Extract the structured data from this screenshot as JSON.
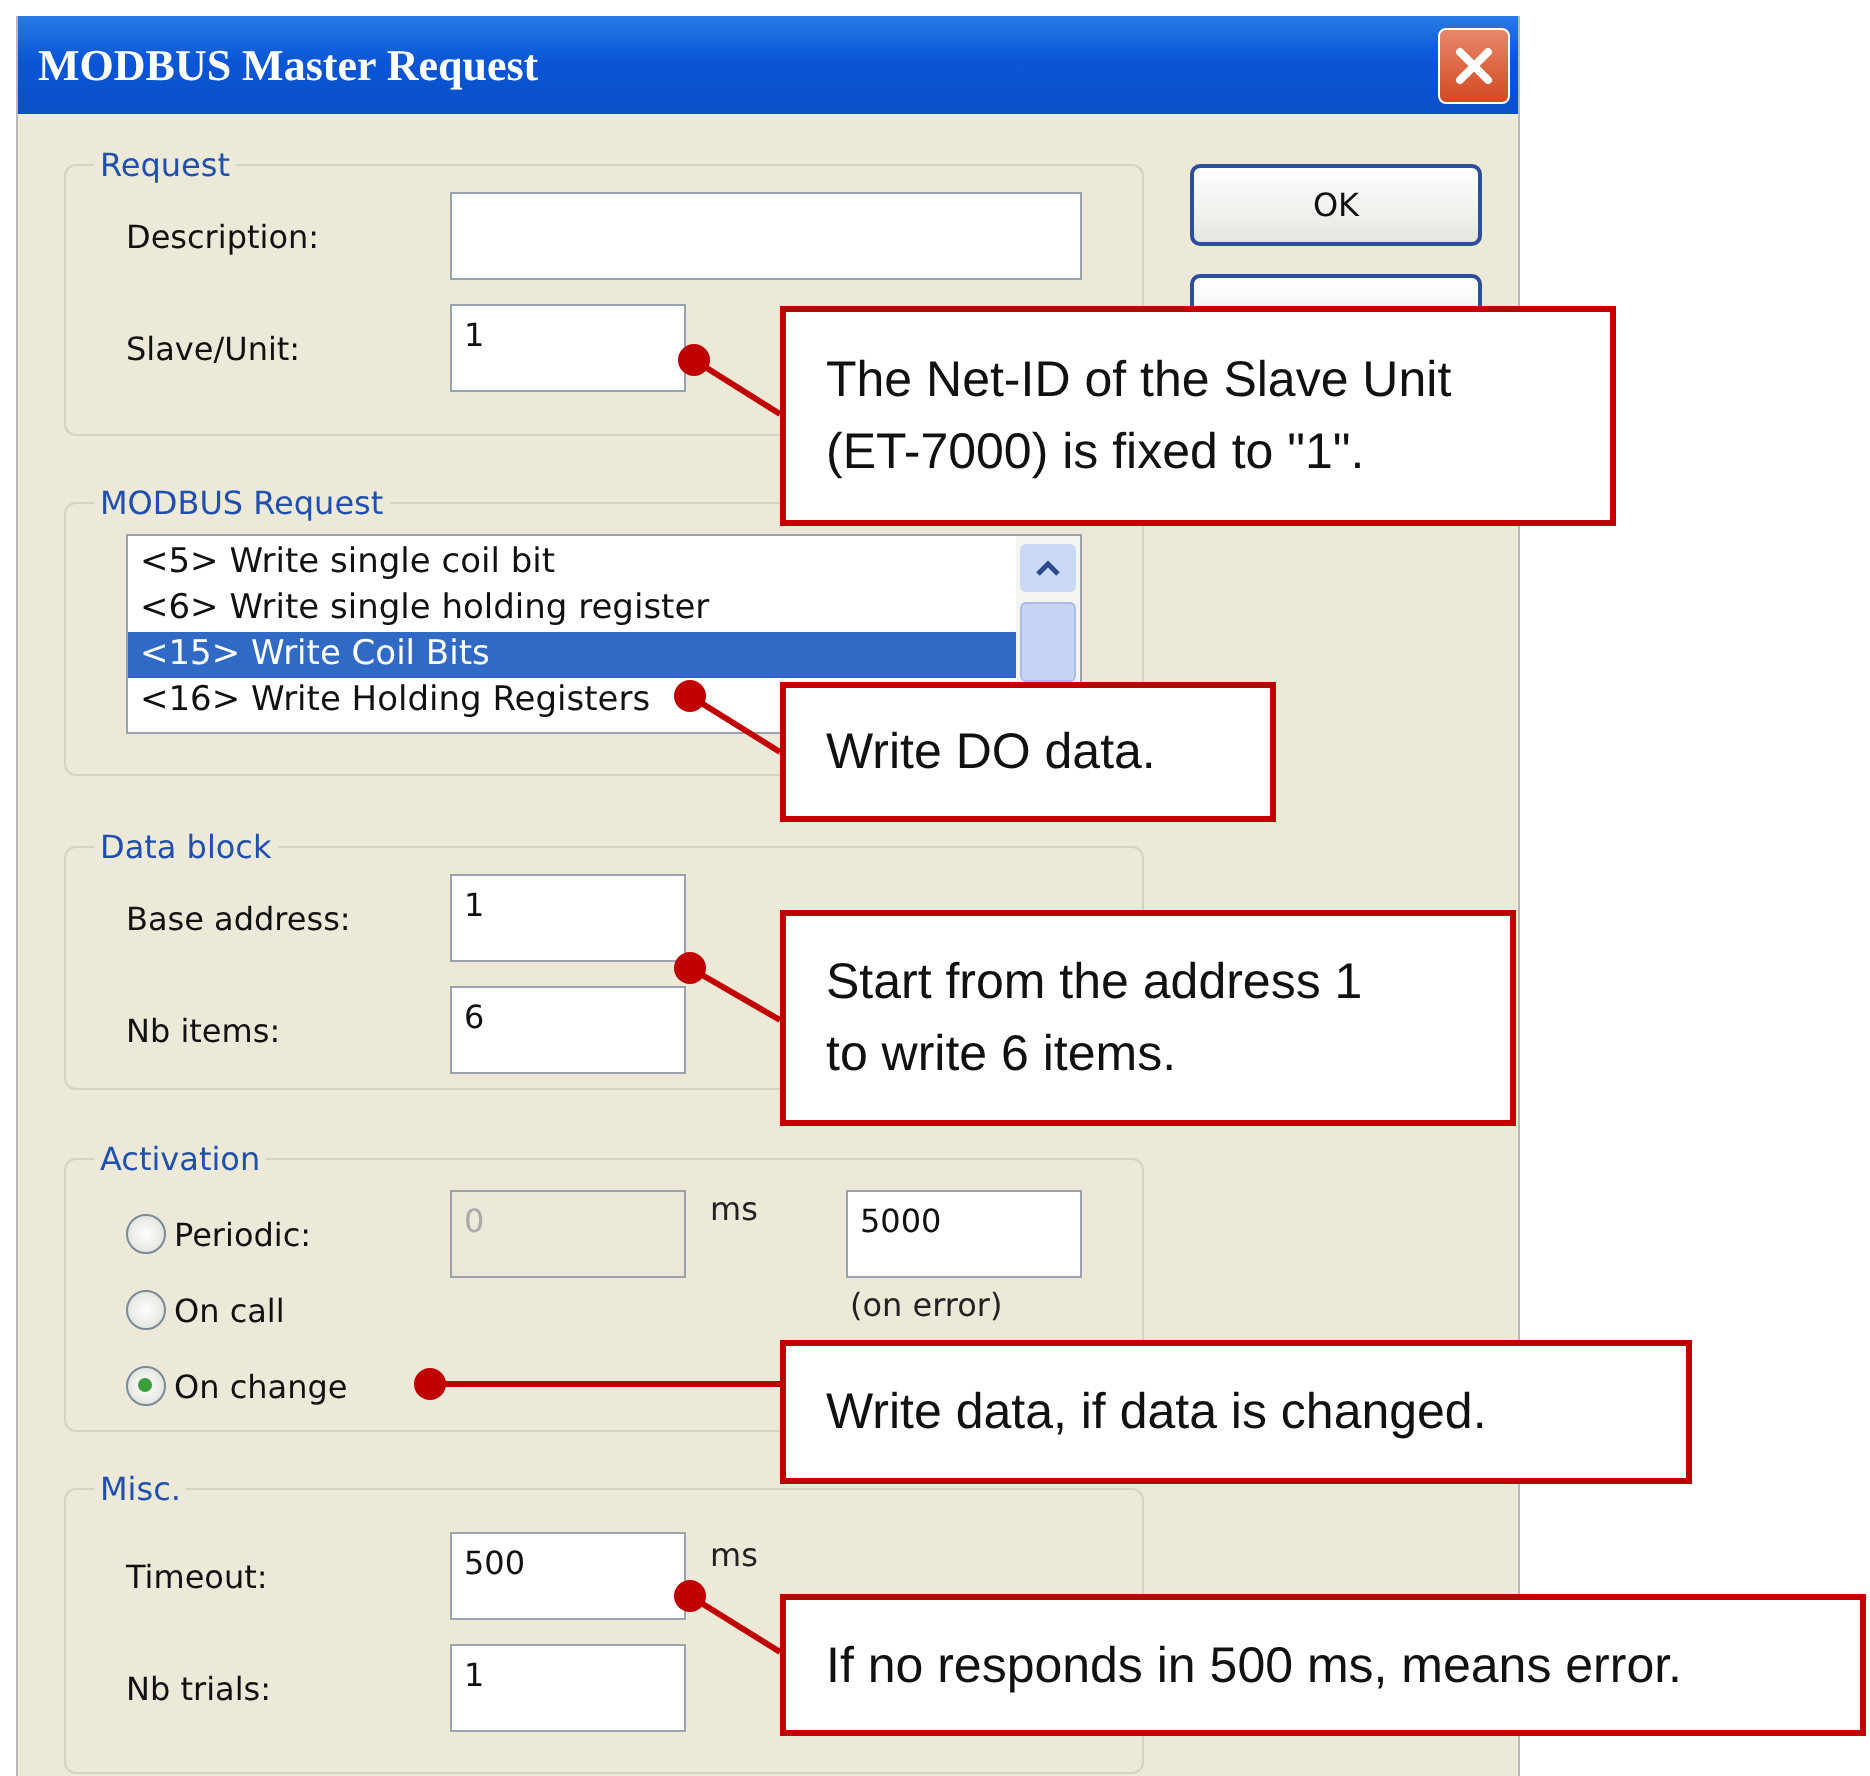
{
  "window": {
    "title": "MODBUS Master Request"
  },
  "request": {
    "title": "Request",
    "fields": [
      {
        "label": "Description:"
      },
      {
        "label": "Slave/Unit:",
        "value": "1"
      }
    ]
  },
  "modbus_request": {
    "title": "MODBUS Request",
    "items": [
      {
        "label": "<5> Write single coil bit",
        "selected": false
      },
      {
        "label": "<6> Write single holding register",
        "selected": false
      },
      {
        "label": "<15> Write Coil Bits",
        "selected": true
      },
      {
        "label": "<16> Write Holding Registers",
        "selected": false
      }
    ]
  },
  "data_block": {
    "title": "Data block",
    "fields": [
      {
        "label": "Base address:",
        "value": "1"
      },
      {
        "label": "Nb items:",
        "value": "6"
      }
    ]
  },
  "activation": {
    "title": "Activation",
    "options": [
      {
        "label": "Periodic:",
        "selected": false
      },
      {
        "label": "On call",
        "selected": false
      },
      {
        "label": "On change",
        "selected": true
      }
    ],
    "period_value": "0",
    "period_unit": "ms",
    "error_value": "5000",
    "error_note": "(on error)"
  },
  "misc": {
    "title": "Misc.",
    "timeout_label": "Timeout:",
    "timeout_value": "500",
    "timeout_unit": "ms",
    "trials_label": "Nb trials:",
    "trials_value": "1"
  },
  "buttons": [
    "OK"
  ],
  "callouts": [
    "The Net-ID of the Slave Unit (ET-7000) is fixed to \"1\".",
    "Write DO data.",
    "Start from the address 1 to write 6 items.",
    "Write data, if data is changed.",
    "If no responds in 500 ms, means error."
  ]
}
